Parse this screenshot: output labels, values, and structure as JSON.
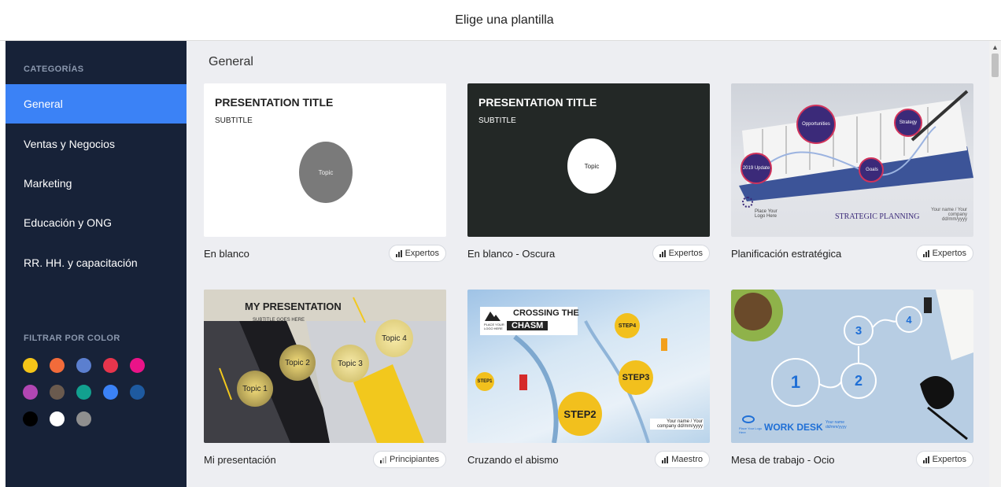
{
  "header": {
    "title": "Elige una plantilla"
  },
  "sidebar": {
    "categories_heading": "CATEGORÍAS",
    "items": [
      {
        "label": "General",
        "active": true
      },
      {
        "label": "Ventas y Negocios"
      },
      {
        "label": "Marketing"
      },
      {
        "label": "Educación y ONG"
      },
      {
        "label": "RR. HH. y capacitación"
      }
    ],
    "filter_heading": "FILTRAR POR COLOR",
    "colors": [
      "#f5c518",
      "#f26b3a",
      "#5b7fcf",
      "#e8354c",
      "#ea1388",
      "#b146b3",
      "#6a5a4e",
      "#12a08f",
      "#3b82f6",
      "#1e5aa0",
      "#000000",
      "#ffffff",
      "#8f8f8f"
    ]
  },
  "main": {
    "section_title": "General",
    "templates": [
      {
        "name": "En blanco",
        "level": "Expertos",
        "thumb": {
          "title": "PRESENTATION TITLE",
          "subtitle": "SUBTITLE",
          "topic": "Topic"
        }
      },
      {
        "name": "En blanco - Oscura",
        "level": "Expertos",
        "thumb": {
          "title": "PRESENTATION TITLE",
          "subtitle": "SUBTITLE",
          "topic": "Topic"
        }
      },
      {
        "name": "Planificación estratégica",
        "level": "Expertos",
        "thumb": {
          "opportunities": "Opportunities",
          "strategy": "Strategy",
          "update": "2019 Update",
          "goals": "Goals",
          "logo": "Place Your Logo Here",
          "title": "STRATEGIC PLANNING",
          "footer": "Your name / Your company dd/mm/yyyy"
        }
      },
      {
        "name": "Mi presentación",
        "level": "Principiantes",
        "thumb": {
          "title": "MY PRESENTATION",
          "subtitle": "SUBTITLE GOES HERE",
          "topics": [
            "Topic 1",
            "Topic 2",
            "Topic 3",
            "Topic 4"
          ]
        }
      },
      {
        "name": "Cruzando el abismo",
        "level": "Maestro",
        "thumb": {
          "title_line1": "CROSSING THE",
          "title_line2": "CHASM",
          "logo": "PLACE YOUR LOGO HERE",
          "steps": [
            "STEP1",
            "STEP2",
            "STEP3",
            "STEP4"
          ],
          "footer": "Your name / Your company dd/mm/yyyy"
        }
      },
      {
        "name": "Mesa de trabajo - Ocio",
        "level": "Expertos",
        "thumb": {
          "numbers": [
            "1",
            "2",
            "3",
            "4"
          ],
          "logo": "Place Your Logo Here",
          "title": "WORK DESK",
          "footer": "Your name dd/mm/yyyy"
        }
      }
    ]
  }
}
